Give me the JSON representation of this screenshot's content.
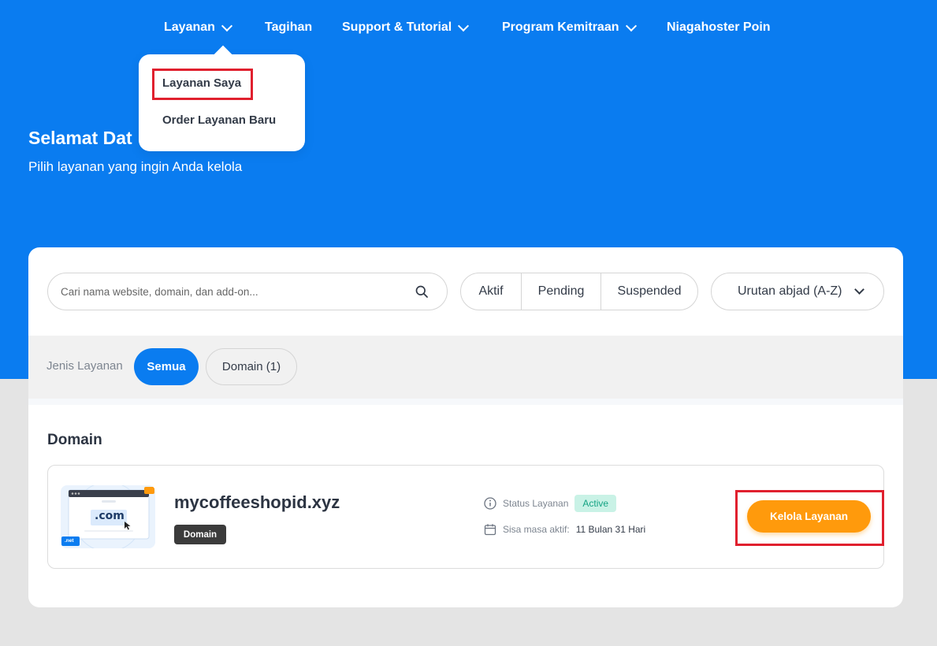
{
  "colors": {
    "primary_blue": "#0a7cf0",
    "accent_orange": "#ff9a0c",
    "highlight_red": "#e0202e",
    "status_active_bg": "#c9f2e6",
    "status_active_text": "#14a383"
  },
  "nav": {
    "items": [
      {
        "label": "Layanan",
        "has_dropdown": true
      },
      {
        "label": "Tagihan",
        "has_dropdown": false
      },
      {
        "label": "Support & Tutorial",
        "has_dropdown": true
      },
      {
        "label": "Program Kemitraan",
        "has_dropdown": true
      },
      {
        "label": "Niagahoster Poin",
        "has_dropdown": false
      }
    ],
    "dropdown": [
      {
        "label": "Layanan Saya",
        "highlighted": true
      },
      {
        "label": "Order Layanan Baru",
        "highlighted": false
      }
    ]
  },
  "hero": {
    "title": "Selamat Dat",
    "subtitle": "Pilih layanan yang ingin Anda kelola"
  },
  "search": {
    "placeholder": "Cari nama website, domain, dan add-on...",
    "value": "",
    "icon": "search-icon"
  },
  "filters": [
    "Aktif",
    "Pending",
    "Suspended"
  ],
  "sort": {
    "selected": "Urutan abjad (A-Z)",
    "icon": "chevron-down-icon"
  },
  "service_types": {
    "label": "Jenis Layanan",
    "options": [
      {
        "label": "Semua",
        "active": true
      },
      {
        "label": "Domain (1)",
        "active": false
      }
    ]
  },
  "section": {
    "title": "Domain",
    "services": [
      {
        "name": "mycoffeeshopid.xyz",
        "type_badge": "Domain",
        "thumb_text": ".com",
        "thumb_tag": ".net",
        "status_label": "Status Layanan",
        "status": "Active",
        "remaining_label": "Sisa masa aktif:",
        "remaining": "11 Bulan 31 Hari",
        "action_label": "Kelola Layanan"
      }
    ]
  }
}
